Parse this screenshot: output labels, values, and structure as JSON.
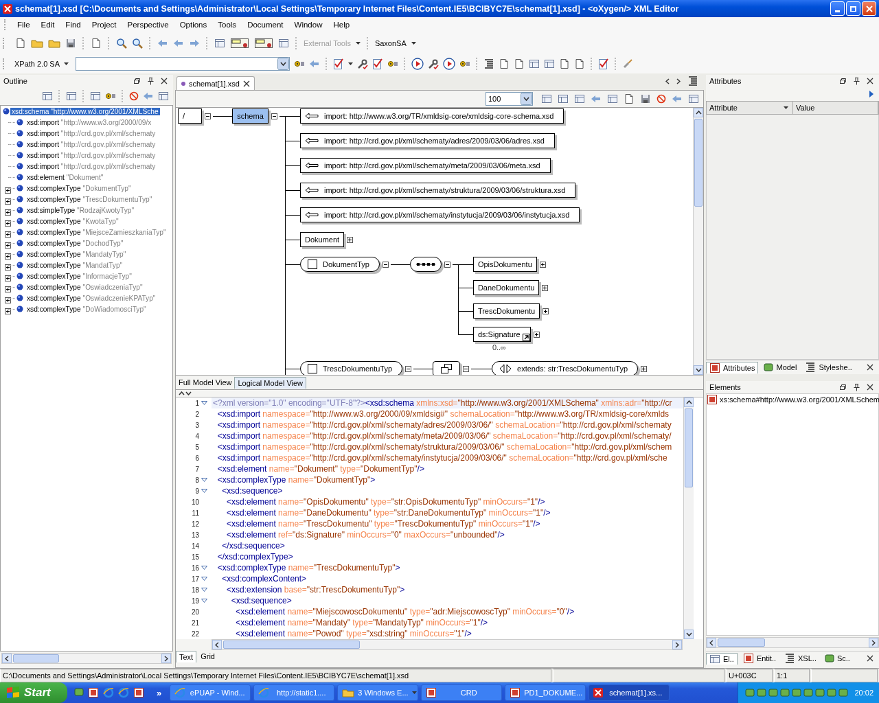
{
  "window": {
    "title": "schemat[1].xsd [C:\\Documents and Settings\\Administrator\\Local Settings\\Temporary Internet Files\\Content.IE5\\BCIBYC7E\\schemat[1].xsd] - <oXygen/> XML Editor"
  },
  "menu": [
    "File",
    "Edit",
    "Find",
    "Project",
    "Perspective",
    "Options",
    "Tools",
    "Document",
    "Window",
    "Help"
  ],
  "toolbar": {
    "external_tools": {
      "label": "External Tools",
      "disabled": true
    },
    "transformer": "SaxonSA",
    "xpath_version": "XPath 2.0 SA"
  },
  "outline": {
    "title": "Outline",
    "tree": [
      {
        "tag": "xsd:schema",
        "value": "\"http://www.w3.org/2001/XMLSche",
        "selected": true,
        "children": [
          {
            "tag": "xsd:import",
            "value": "\"http://www.w3.org/2000/09/x",
            "selected": false
          },
          {
            "tag": "xsd:import",
            "value": "\"http://crd.gov.pl/xml/schematy",
            "selected": false
          },
          {
            "tag": "xsd:import",
            "value": "\"http://crd.gov.pl/xml/schematy",
            "selected": false
          },
          {
            "tag": "xsd:import",
            "value": "\"http://crd.gov.pl/xml/schematy",
            "selected": false
          },
          {
            "tag": "xsd:import",
            "value": "\"http://crd.gov.pl/xml/schematy",
            "selected": false
          },
          {
            "tag": "xsd:element",
            "value": "\"Dokument\"",
            "selected": false
          },
          {
            "tag": "xsd:complexType",
            "value": "\"DokumentTyp\"",
            "selected": false,
            "expanded": false
          },
          {
            "tag": "xsd:complexType",
            "value": "\"TrescDokumentuTyp\"",
            "selected": false,
            "expanded": false
          },
          {
            "tag": "xsd:simpleType",
            "value": "\"RodzajKwotyTyp\"",
            "selected": false,
            "expanded": false
          },
          {
            "tag": "xsd:complexType",
            "value": "\"KwotaTyp\"",
            "selected": false,
            "expanded": false
          },
          {
            "tag": "xsd:complexType",
            "value": "\"MiejsceZamieszkaniaTyp\"",
            "selected": false,
            "expanded": false
          },
          {
            "tag": "xsd:complexType",
            "value": "\"DochodTyp\"",
            "selected": false,
            "expanded": false
          },
          {
            "tag": "xsd:complexType",
            "value": "\"MandatyTyp\"",
            "selected": false,
            "expanded": false
          },
          {
            "tag": "xsd:complexType",
            "value": "\"MandatTyp\"",
            "selected": false,
            "expanded": false
          },
          {
            "tag": "xsd:complexType",
            "value": "\"InformacjeTyp\"",
            "selected": false,
            "expanded": false
          },
          {
            "tag": "xsd:complexType",
            "value": "\"OswiadczeniaTyp\"",
            "selected": false,
            "expanded": false
          },
          {
            "tag": "xsd:complexType",
            "value": "\"OswiadczenieKPATyp\"",
            "selected": false,
            "expanded": false
          },
          {
            "tag": "xsd:complexType",
            "value": "\"DoWiadomosciTyp\"",
            "selected": false,
            "expanded": false
          }
        ]
      }
    ]
  },
  "editor": {
    "tabs": [
      {
        "label": "schemat[1].xsd",
        "selected": true
      }
    ],
    "zoom": "100",
    "diagram": {
      "root": {
        "label": "/",
        "expanded": true
      },
      "schema": {
        "label": "schema",
        "selected": true,
        "expanded": true
      },
      "children": [
        {
          "kind": "import",
          "label": "import: http://www.w3.org/TR/xmldsig-core/xmldsig-core-schema.xsd"
        },
        {
          "kind": "import",
          "label": "import: http://crd.gov.pl/xml/schematy/adres/2009/03/06/adres.xsd"
        },
        {
          "kind": "import",
          "label": "import: http://crd.gov.pl/xml/schematy/meta/2009/03/06/meta.xsd"
        },
        {
          "kind": "import",
          "label": "import: http://crd.gov.pl/xml/schematy/struktura/2009/03/06/struktura.xsd"
        },
        {
          "kind": "import",
          "label": "import: http://crd.gov.pl/xml/schematy/instytucja/2009/03/06/instytucja.xsd"
        },
        {
          "kind": "element",
          "label": "Dokument",
          "expanded": false
        },
        {
          "kind": "complex_type",
          "label": "DokumentTyp",
          "expanded": true,
          "compositor": {
            "kind": "sequence",
            "expanded": true
          },
          "children": [
            {
              "kind": "element",
              "label": "OpisDokumentu",
              "expanded": false
            },
            {
              "kind": "element",
              "label": "DaneDokumentu",
              "expanded": false
            },
            {
              "kind": "element",
              "label": "TrescDokumentu",
              "expanded": false
            },
            {
              "kind": "element_ref",
              "label": "ds:Signature",
              "expanded": false,
              "occurs": "0..∞"
            }
          ]
        },
        {
          "kind": "complex_type",
          "label": "TrescDokumentuTyp",
          "expanded": true,
          "compositor": {
            "kind": "complex_content",
            "expanded": true
          },
          "children": [
            {
              "kind": "extension",
              "label": "extends: str:TrescDokumentuTyp",
              "expanded": false
            }
          ]
        }
      ]
    },
    "view_tabs": [
      {
        "label": "Full Model View",
        "selected": false
      },
      {
        "label": "Logical Model View",
        "selected": true
      }
    ],
    "code_lines": [
      {
        "number": "1",
        "fold": true,
        "current": true,
        "tokens": [
          {
            "kind": "pi",
            "text": "<?xml version=\"1.0\" encoding=\"UTF-8\"?>"
          },
          {
            "kind": "tag",
            "text": "<xsd:schema"
          },
          {
            "kind": "attr",
            "text": " xmlns:xsd="
          },
          {
            "kind": "val",
            "text": "\"http://www.w3.org/2001/XMLSchema\""
          },
          {
            "kind": "attr",
            "text": " xmlns:adr="
          },
          {
            "kind": "val",
            "text": "\"http://cr"
          }
        ]
      },
      {
        "number": "2",
        "fold": false,
        "current": false,
        "tokens": [
          {
            "kind": "tag",
            "text": "  <xsd:import"
          },
          {
            "kind": "attr",
            "text": " namespace="
          },
          {
            "kind": "val",
            "text": "\"http://www.w3.org/2000/09/xmldsig#\""
          },
          {
            "kind": "attr",
            "text": " schemaLocation="
          },
          {
            "kind": "val",
            "text": "\"http://www.w3.org/TR/xmldsig-core/xmlds"
          }
        ]
      },
      {
        "number": "3",
        "fold": false,
        "current": false,
        "tokens": [
          {
            "kind": "tag",
            "text": "  <xsd:import"
          },
          {
            "kind": "attr",
            "text": " namespace="
          },
          {
            "kind": "val",
            "text": "\"http://crd.gov.pl/xml/schematy/adres/2009/03/06/\""
          },
          {
            "kind": "attr",
            "text": " schemaLocation="
          },
          {
            "kind": "val",
            "text": "\"http://crd.gov.pl/xml/schematy"
          }
        ]
      },
      {
        "number": "4",
        "fold": false,
        "current": false,
        "tokens": [
          {
            "kind": "tag",
            "text": "  <xsd:import"
          },
          {
            "kind": "attr",
            "text": " namespace="
          },
          {
            "kind": "val",
            "text": "\"http://crd.gov.pl/xml/schematy/meta/2009/03/06/\""
          },
          {
            "kind": "attr",
            "text": " schemaLocation="
          },
          {
            "kind": "val",
            "text": "\"http://crd.gov.pl/xml/schematy/"
          }
        ]
      },
      {
        "number": "5",
        "fold": false,
        "current": false,
        "tokens": [
          {
            "kind": "tag",
            "text": "  <xsd:import"
          },
          {
            "kind": "attr",
            "text": " namespace="
          },
          {
            "kind": "val",
            "text": "\"http://crd.gov.pl/xml/schematy/struktura/2009/03/06/\""
          },
          {
            "kind": "attr",
            "text": " schemaLocation="
          },
          {
            "kind": "val",
            "text": "\"http://crd.gov.pl/xml/schem"
          }
        ]
      },
      {
        "number": "6",
        "fold": false,
        "current": false,
        "tokens": [
          {
            "kind": "tag",
            "text": "  <xsd:import"
          },
          {
            "kind": "attr",
            "text": " namespace="
          },
          {
            "kind": "val",
            "text": "\"http://crd.gov.pl/xml/schematy/instytucja/2009/03/06/\""
          },
          {
            "kind": "attr",
            "text": " schemaLocation="
          },
          {
            "kind": "val",
            "text": "\"http://crd.gov.pl/xml/sche"
          }
        ]
      },
      {
        "number": "7",
        "fold": false,
        "current": false,
        "tokens": [
          {
            "kind": "tag",
            "text": "  <xsd:element"
          },
          {
            "kind": "attr",
            "text": " name="
          },
          {
            "kind": "val",
            "text": "\"Dokument\""
          },
          {
            "kind": "attr",
            "text": " type="
          },
          {
            "kind": "val",
            "text": "\"DokumentTyp\""
          },
          {
            "kind": "tag",
            "text": "/>"
          }
        ]
      },
      {
        "number": "8",
        "fold": true,
        "current": false,
        "tokens": [
          {
            "kind": "tag",
            "text": "  <xsd:complexType"
          },
          {
            "kind": "attr",
            "text": " name="
          },
          {
            "kind": "val",
            "text": "\"DokumentTyp\""
          },
          {
            "kind": "tag",
            "text": ">"
          }
        ]
      },
      {
        "number": "9",
        "fold": true,
        "current": false,
        "tokens": [
          {
            "kind": "tag",
            "text": "    <xsd:sequence>"
          }
        ]
      },
      {
        "number": "10",
        "fold": false,
        "current": false,
        "tokens": [
          {
            "kind": "tag",
            "text": "      <xsd:element"
          },
          {
            "kind": "attr",
            "text": " name="
          },
          {
            "kind": "val",
            "text": "\"OpisDokumentu\""
          },
          {
            "kind": "attr",
            "text": " type="
          },
          {
            "kind": "val",
            "text": "\"str:OpisDokumentuTyp\""
          },
          {
            "kind": "attr",
            "text": " minOccurs="
          },
          {
            "kind": "val",
            "text": "\"1\""
          },
          {
            "kind": "tag",
            "text": "/>"
          }
        ]
      },
      {
        "number": "11",
        "fold": false,
        "current": false,
        "tokens": [
          {
            "kind": "tag",
            "text": "      <xsd:element"
          },
          {
            "kind": "attr",
            "text": " name="
          },
          {
            "kind": "val",
            "text": "\"DaneDokumentu\""
          },
          {
            "kind": "attr",
            "text": " type="
          },
          {
            "kind": "val",
            "text": "\"str:DaneDokumentuTyp\""
          },
          {
            "kind": "attr",
            "text": " minOccurs="
          },
          {
            "kind": "val",
            "text": "\"1\""
          },
          {
            "kind": "tag",
            "text": "/>"
          }
        ]
      },
      {
        "number": "12",
        "fold": false,
        "current": false,
        "tokens": [
          {
            "kind": "tag",
            "text": "      <xsd:element"
          },
          {
            "kind": "attr",
            "text": " name="
          },
          {
            "kind": "val",
            "text": "\"TrescDokumentu\""
          },
          {
            "kind": "attr",
            "text": " type="
          },
          {
            "kind": "val",
            "text": "\"TrescDokumentuTyp\""
          },
          {
            "kind": "attr",
            "text": " minOccurs="
          },
          {
            "kind": "val",
            "text": "\"1\""
          },
          {
            "kind": "tag",
            "text": "/>"
          }
        ]
      },
      {
        "number": "13",
        "fold": false,
        "current": false,
        "tokens": [
          {
            "kind": "tag",
            "text": "      <xsd:element"
          },
          {
            "kind": "attr",
            "text": " ref="
          },
          {
            "kind": "val",
            "text": "\"ds:Signature\""
          },
          {
            "kind": "attr",
            "text": " minOccurs="
          },
          {
            "kind": "val",
            "text": "\"0\""
          },
          {
            "kind": "attr",
            "text": " maxOccurs="
          },
          {
            "kind": "val",
            "text": "\"unbounded\""
          },
          {
            "kind": "tag",
            "text": "/>"
          }
        ]
      },
      {
        "number": "14",
        "fold": false,
        "current": false,
        "tokens": [
          {
            "kind": "tag",
            "text": "    </xsd:sequence>"
          }
        ]
      },
      {
        "number": "15",
        "fold": false,
        "current": false,
        "tokens": [
          {
            "kind": "tag",
            "text": "  </xsd:complexType>"
          }
        ]
      },
      {
        "number": "16",
        "fold": true,
        "current": false,
        "tokens": [
          {
            "kind": "tag",
            "text": "  <xsd:complexType"
          },
          {
            "kind": "attr",
            "text": " name="
          },
          {
            "kind": "val",
            "text": "\"TrescDokumentuTyp\""
          },
          {
            "kind": "tag",
            "text": ">"
          }
        ]
      },
      {
        "number": "17",
        "fold": true,
        "current": false,
        "tokens": [
          {
            "kind": "tag",
            "text": "    <xsd:complexContent>"
          }
        ]
      },
      {
        "number": "18",
        "fold": true,
        "current": false,
        "tokens": [
          {
            "kind": "tag",
            "text": "      <xsd:extension"
          },
          {
            "kind": "attr",
            "text": " base="
          },
          {
            "kind": "val",
            "text": "\"str:TrescDokumentuTyp\""
          },
          {
            "kind": "tag",
            "text": ">"
          }
        ]
      },
      {
        "number": "19",
        "fold": true,
        "current": false,
        "tokens": [
          {
            "kind": "tag",
            "text": "        <xsd:sequence>"
          }
        ]
      },
      {
        "number": "20",
        "fold": false,
        "current": false,
        "tokens": [
          {
            "kind": "tag",
            "text": "          <xsd:element"
          },
          {
            "kind": "attr",
            "text": " name="
          },
          {
            "kind": "val",
            "text": "\"MiejscowoscDokumentu\""
          },
          {
            "kind": "attr",
            "text": " type="
          },
          {
            "kind": "val",
            "text": "\"adr:MiejscowoscTyp\""
          },
          {
            "kind": "attr",
            "text": " minOccurs="
          },
          {
            "kind": "val",
            "text": "\"0\""
          },
          {
            "kind": "tag",
            "text": "/>"
          }
        ]
      },
      {
        "number": "21",
        "fold": false,
        "current": false,
        "tokens": [
          {
            "kind": "tag",
            "text": "          <xsd:element"
          },
          {
            "kind": "attr",
            "text": " name="
          },
          {
            "kind": "val",
            "text": "\"Mandaty\""
          },
          {
            "kind": "attr",
            "text": " type="
          },
          {
            "kind": "val",
            "text": "\"MandatyTyp\""
          },
          {
            "kind": "attr",
            "text": " minOccurs="
          },
          {
            "kind": "val",
            "text": "\"1\""
          },
          {
            "kind": "tag",
            "text": "/>"
          }
        ]
      },
      {
        "number": "22",
        "fold": false,
        "current": false,
        "tokens": [
          {
            "kind": "tag",
            "text": "          <xsd:element"
          },
          {
            "kind": "attr",
            "text": " name="
          },
          {
            "kind": "val",
            "text": "\"Powod\""
          },
          {
            "kind": "attr",
            "text": " type="
          },
          {
            "kind": "val",
            "text": "\"xsd:string\""
          },
          {
            "kind": "attr",
            "text": " minOccurs="
          },
          {
            "kind": "val",
            "text": "\"1\""
          },
          {
            "kind": "tag",
            "text": "/>"
          }
        ]
      }
    ],
    "mode_tabs": [
      {
        "label": "Text",
        "selected": true
      },
      {
        "label": "Grid",
        "selected": false
      }
    ]
  },
  "attributes_panel": {
    "title": "Attributes",
    "columns": [
      "Attribute",
      "Value"
    ],
    "tabs": [
      {
        "label": "Attributes",
        "selected": true
      },
      {
        "label": "Model",
        "selected": false
      },
      {
        "label": "Styleshe..",
        "selected": false
      }
    ]
  },
  "elements_panel": {
    "title": "Elements",
    "items": [
      "xs:schema#http://www.w3.org/2001/XMLSchem"
    ],
    "tabs": [
      {
        "label": "El..",
        "selected": true
      },
      {
        "label": "Entit..",
        "selected": false
      },
      {
        "label": "XSL..",
        "selected": false
      },
      {
        "label": "Sc..",
        "selected": false
      }
    ]
  },
  "status_bar": {
    "path": "C:\\Documents and Settings\\Administrator\\Local Settings\\Temporary Internet Files\\Content.IE5\\BCIBYC7E\\schemat[1].xsd",
    "char_code": "U+003C",
    "position": "1:1"
  },
  "taskbar": {
    "start": "Start",
    "overflow": "»",
    "clock": "20:02",
    "tasks": [
      {
        "kind": "browser",
        "label": "ePUAP - Wind...",
        "selected": false
      },
      {
        "kind": "browser",
        "label": "http://static1....",
        "selected": false
      },
      {
        "kind": "folder",
        "label": "3 Windows E...",
        "selected": false
      },
      {
        "kind": "document",
        "label": "CRD",
        "selected": false
      },
      {
        "kind": "document",
        "label": "PD1_DOKUME...",
        "selected": false
      },
      {
        "kind": "app",
        "label": "schemat[1].xs...",
        "selected": true
      }
    ]
  }
}
